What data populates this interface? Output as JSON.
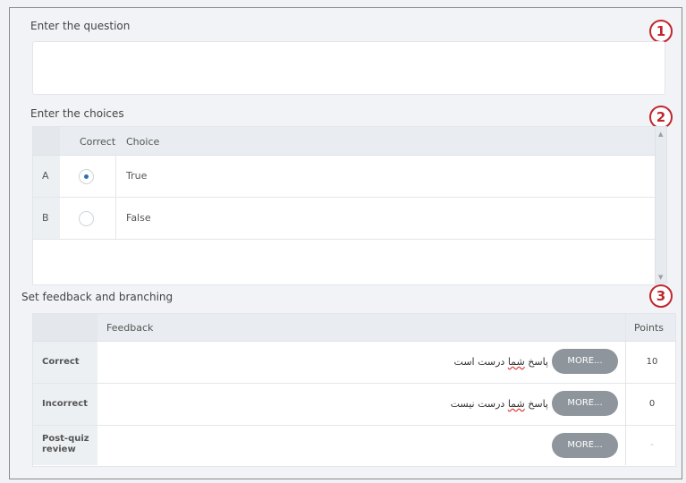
{
  "question": {
    "title": "Enter the question",
    "marker": "1",
    "value": ""
  },
  "choices": {
    "title": "Enter the choices",
    "marker": "2",
    "headers": {
      "correct": "Correct",
      "choice": "Choice"
    },
    "rows": [
      {
        "letter": "A",
        "selected": true,
        "text": "True"
      },
      {
        "letter": "B",
        "selected": false,
        "text": "False"
      }
    ],
    "scroll_up": "▲",
    "scroll_down": "▼"
  },
  "feedback": {
    "title": "Set feedback and branching",
    "marker": "3",
    "headers": {
      "feedback": "Feedback",
      "points": "Points"
    },
    "rows": [
      {
        "label": "Correct",
        "text_pre": "پاسخ ",
        "text_u": "شما",
        "text_post": " درست است",
        "more": "MORE...",
        "points": "10"
      },
      {
        "label": "Incorrect",
        "text_pre": "پاسخ ",
        "text_u": "شما",
        "text_post": " درست نیست",
        "more": "MORE...",
        "points": "0"
      },
      {
        "label_line1": "Post-quiz",
        "label_line2": "review",
        "more": "MORE...",
        "points": "-"
      }
    ]
  }
}
